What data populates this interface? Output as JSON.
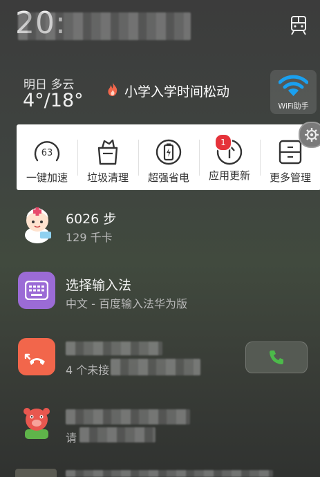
{
  "status": {
    "time": "20:"
  },
  "weather": {
    "day_label": "明日 多云",
    "temp_range": "4°/18°"
  },
  "news": {
    "headline": "小学入学时间松动"
  },
  "wifi_helper": {
    "label": "WiFi助手"
  },
  "tools": [
    {
      "label": "一键加速",
      "value": "63",
      "icon": "gauge-icon"
    },
    {
      "label": "垃圾清理",
      "icon": "trash-bag-icon"
    },
    {
      "label": "超强省电",
      "icon": "battery-icon"
    },
    {
      "label": "应用更新",
      "badge": "1",
      "icon": "upload-icon"
    },
    {
      "label": "更多管理",
      "icon": "toolbox-icon"
    }
  ],
  "notifications": {
    "steps": {
      "title": "6026 步",
      "subtitle": "129 千卡"
    },
    "ime": {
      "title": "选择输入法",
      "subtitle": "中文 - 百度输入法华为版"
    },
    "missed": {
      "subtitle": "4 个未接"
    },
    "message": {
      "subtitle": "请"
    }
  },
  "colors": {
    "accent_orange": "#f2664b",
    "ime_purple": "#9b6bd6",
    "call_green": "#4cba4a",
    "badge_red": "#e5323a"
  }
}
